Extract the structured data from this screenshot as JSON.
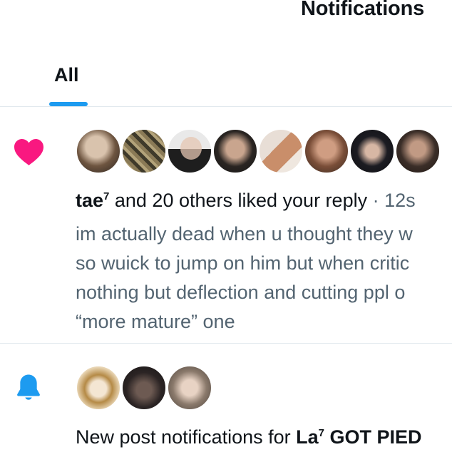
{
  "header": {
    "title": "Notifications"
  },
  "tabs": [
    {
      "label": "All",
      "active": true
    }
  ],
  "colors": {
    "accent": "#1d9bf0",
    "like": "#f91880",
    "secondary_text": "#536471",
    "primary_text": "#0f1419"
  },
  "notifications": [
    {
      "type": "like",
      "icon": "heart-icon",
      "user": "tae",
      "user_sup": "7",
      "action": " and 20 others liked your reply",
      "time": " · 12s",
      "reply_lines": [
        "im actually dead when u thought they w",
        "so wuick to jump on him but when critic",
        "nothing but deflection and cutting ppl o",
        "“more mature” one"
      ]
    },
    {
      "type": "new_post",
      "icon": "bell-icon",
      "prefix": "New post notifications for ",
      "account": "La",
      "account_sup": "7",
      "account_rest": " GOT PIED"
    }
  ]
}
